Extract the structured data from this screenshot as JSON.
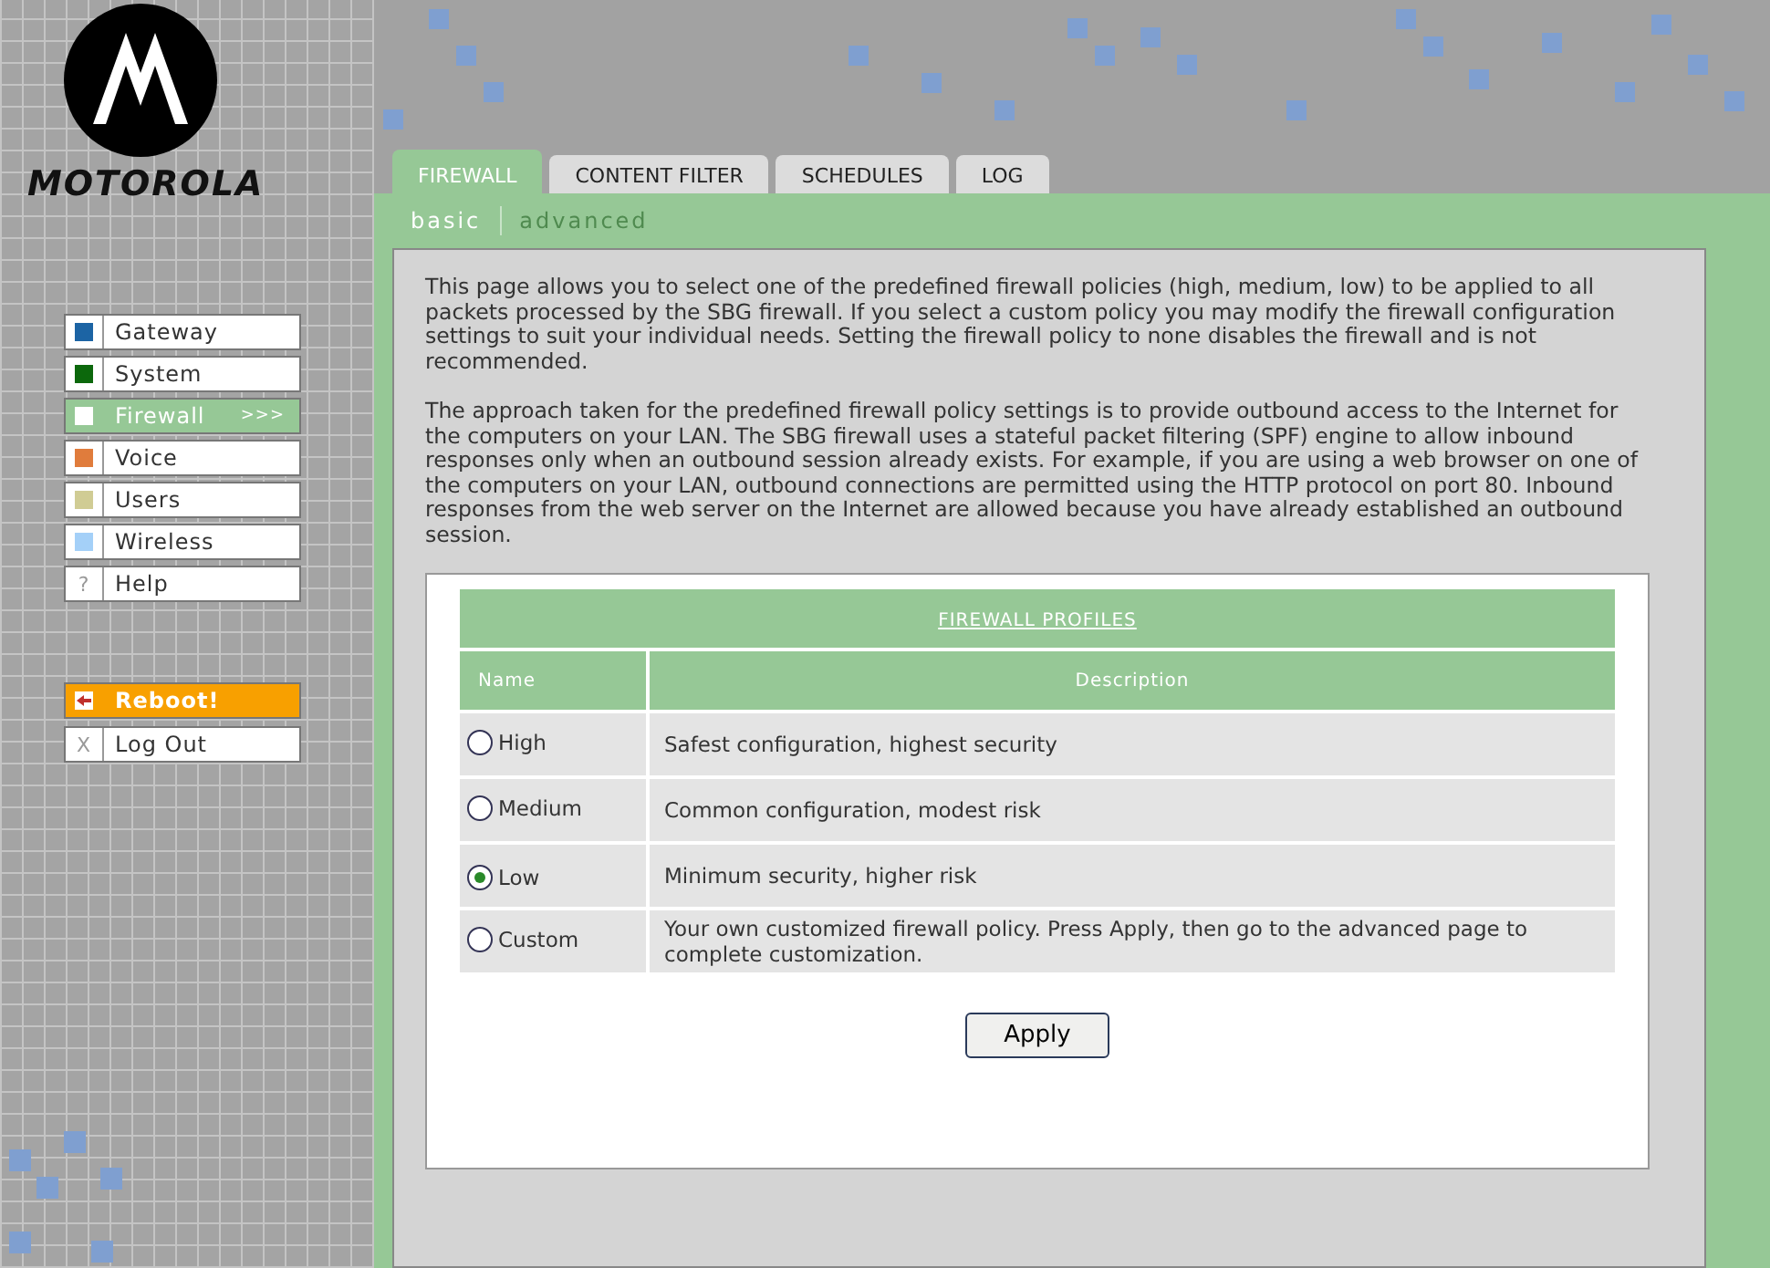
{
  "brand": "MOTOROLA",
  "tabs": [
    {
      "label": "FIREWALL",
      "selected": true
    },
    {
      "label": "CONTENT FILTER",
      "selected": false
    },
    {
      "label": "SCHEDULES",
      "selected": false
    },
    {
      "label": "LOG",
      "selected": false
    }
  ],
  "subnav": [
    {
      "label": "basic",
      "selected": true
    },
    {
      "label": "advanced",
      "selected": false
    }
  ],
  "sidebar": {
    "items": [
      {
        "label": "Gateway",
        "kind": "swatch",
        "color": "#1c64a4",
        "selected": false
      },
      {
        "label": "System",
        "kind": "swatch",
        "color": "#0c680c",
        "selected": false
      },
      {
        "label": "Firewall",
        "kind": "swatch",
        "color": "#ffffff",
        "selected": true,
        "indicator": ">>>"
      },
      {
        "label": "Voice",
        "kind": "swatch",
        "color": "#e07c3c",
        "selected": false
      },
      {
        "label": "Users",
        "kind": "swatch",
        "color": "#d0cc94",
        "selected": false
      },
      {
        "label": "Wireless",
        "kind": "swatch",
        "color": "#a4d0f8",
        "selected": false
      },
      {
        "label": "Help",
        "kind": "glyph",
        "glyph": "?",
        "selected": false
      }
    ],
    "actions": [
      {
        "label": "Reboot!",
        "kind": "reboot"
      },
      {
        "label": "Log Out",
        "kind": "logout",
        "glyph": "X"
      }
    ]
  },
  "paragraphs": [
    "This page allows you to select one of the predefined firewall policies (high, medium, low) to be applied to all packets processed by the SBG firewall. If you select a custom policy you may modify the firewall configuration settings to suit your individual needs. Setting the firewall policy to none disables the firewall and is not recommended.",
    "The approach taken for the predefined firewall policy settings is to provide outbound access to the Internet for the computers on your LAN. The SBG firewall uses a stateful packet filtering (SPF) engine to allow inbound responses only when an outbound session already exists. For example, if you are using a web browser on one of the computers on your LAN, outbound connections are permitted using the HTTP protocol on port 80. Inbound responses from the web server on the Internet are allowed because you have already established an outbound session."
  ],
  "table": {
    "title": "FIREWALL PROFILES",
    "columns": [
      "Name",
      "Description"
    ],
    "rows": [
      {
        "name": "High",
        "description": "Safest configuration, highest security",
        "selected": false
      },
      {
        "name": "Medium",
        "description": "Common configuration, modest risk",
        "selected": false
      },
      {
        "name": "Low",
        "description": "Minimum security, higher risk",
        "selected": true
      },
      {
        "name": "Custom",
        "description": "Your own customized firewall policy. Press Apply, then go to the advanced page to complete customization.",
        "selected": false
      }
    ]
  },
  "apply_button": "Apply"
}
